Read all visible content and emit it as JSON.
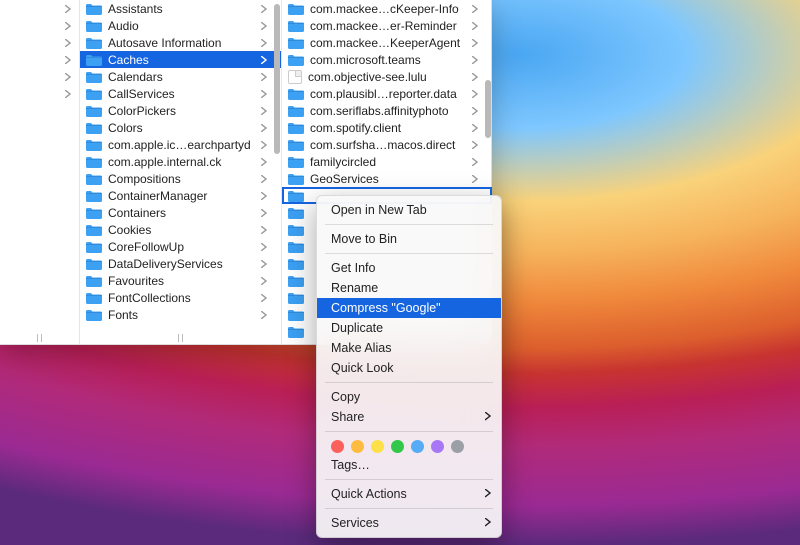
{
  "columnB": {
    "items": [
      {
        "label": "Assistants"
      },
      {
        "label": "Audio"
      },
      {
        "label": "Autosave Information"
      },
      {
        "label": "Caches",
        "selected": true
      },
      {
        "label": "Calendars"
      },
      {
        "label": "CallServices"
      },
      {
        "label": "ColorPickers"
      },
      {
        "label": "Colors"
      },
      {
        "label": "com.apple.ic…earchpartyd"
      },
      {
        "label": "com.apple.internal.ck"
      },
      {
        "label": "Compositions"
      },
      {
        "label": "ContainerManager"
      },
      {
        "label": "Containers"
      },
      {
        "label": "Cookies"
      },
      {
        "label": "CoreFollowUp"
      },
      {
        "label": "DataDeliveryServices"
      },
      {
        "label": "Favourites"
      },
      {
        "label": "FontCollections"
      },
      {
        "label": "Fonts"
      }
    ]
  },
  "columnC": {
    "items": [
      {
        "label": "com.mackee…cKeeper-Info",
        "type": "folder"
      },
      {
        "label": "com.mackee…er-Reminder",
        "type": "folder"
      },
      {
        "label": "com.mackee…KeeperAgent",
        "type": "folder"
      },
      {
        "label": "com.microsoft.teams",
        "type": "folder"
      },
      {
        "label": "com.objective-see.lulu",
        "type": "doc"
      },
      {
        "label": "com.plausibl…reporter.data",
        "type": "folder"
      },
      {
        "label": "com.seriflabs.affinityphoto",
        "type": "folder"
      },
      {
        "label": "com.spotify.client",
        "type": "folder"
      },
      {
        "label": "com.surfsha…macos.direct",
        "type": "folder"
      },
      {
        "label": "familycircled",
        "type": "folder"
      },
      {
        "label": "GeoServices",
        "type": "folder"
      }
    ],
    "contextTargetIndex": 11,
    "stubRows": 8
  },
  "contextMenu": {
    "groups": [
      [
        {
          "label": "Open in New Tab"
        }
      ],
      [
        {
          "label": "Move to Bin"
        }
      ],
      [
        {
          "label": "Get Info"
        },
        {
          "label": "Rename"
        },
        {
          "label": "Compress \"Google\"",
          "highlighted": true
        },
        {
          "label": "Duplicate"
        },
        {
          "label": "Make Alias"
        },
        {
          "label": "Quick Look"
        }
      ],
      [
        {
          "label": "Copy"
        },
        {
          "label": "Share",
          "submenu": true
        }
      ],
      [
        {
          "type": "tags",
          "colors": [
            "#fc605c",
            "#fdbc40",
            "#fde047",
            "#34c84a",
            "#57acf5",
            "#a877f5",
            "#9aa0a6"
          ]
        },
        {
          "label": "Tags…"
        }
      ],
      [
        {
          "label": "Quick Actions",
          "submenu": true
        }
      ],
      [
        {
          "label": "Services",
          "submenu": true
        }
      ]
    ]
  },
  "columnA": {
    "rows": 6
  }
}
